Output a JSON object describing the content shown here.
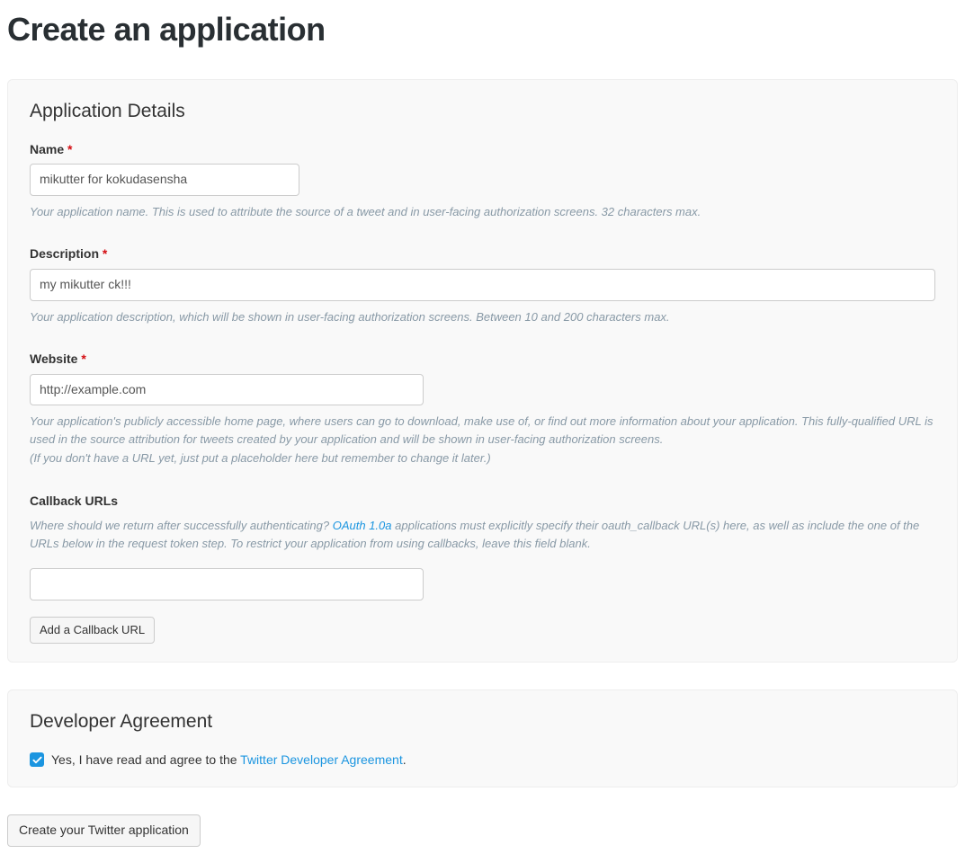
{
  "page": {
    "title": "Create an application"
  },
  "details": {
    "section_title": "Application Details",
    "name": {
      "label": "Name",
      "required": "*",
      "value": "mikutter for kokudasensha",
      "help": "Your application name. This is used to attribute the source of a tweet and in user-facing authorization screens. 32 characters max."
    },
    "description": {
      "label": "Description",
      "required": "*",
      "value": "my mikutter ck!!!",
      "help": "Your application description, which will be shown in user-facing authorization screens. Between 10 and 200 characters max."
    },
    "website": {
      "label": "Website",
      "required": "*",
      "value": "http://example.com",
      "help1": "Your application's publicly accessible home page, where users can go to download, make use of, or find out more information about your application. This fully-qualified URL is used in the source attribution for tweets created by your application and will be shown in user-facing authorization screens.",
      "help2": "(If you don't have a URL yet, just put a placeholder here but remember to change it later.)"
    },
    "callback": {
      "label": "Callback URLs",
      "help_pre": "Where should we return after successfully authenticating? ",
      "help_link": "OAuth 1.0a",
      "help_post": " applications must explicitly specify their oauth_callback URL(s) here, as well as include the one of the URLs below in the request token step. To restrict your application from using callbacks, leave this field blank.",
      "value": "",
      "add_button": "Add a Callback URL"
    }
  },
  "agreement": {
    "section_title": "Developer Agreement",
    "text_pre": "Yes, I have read and agree to the ",
    "text_link": "Twitter Developer Agreement",
    "text_post": "."
  },
  "submit": {
    "label": "Create your Twitter application"
  }
}
